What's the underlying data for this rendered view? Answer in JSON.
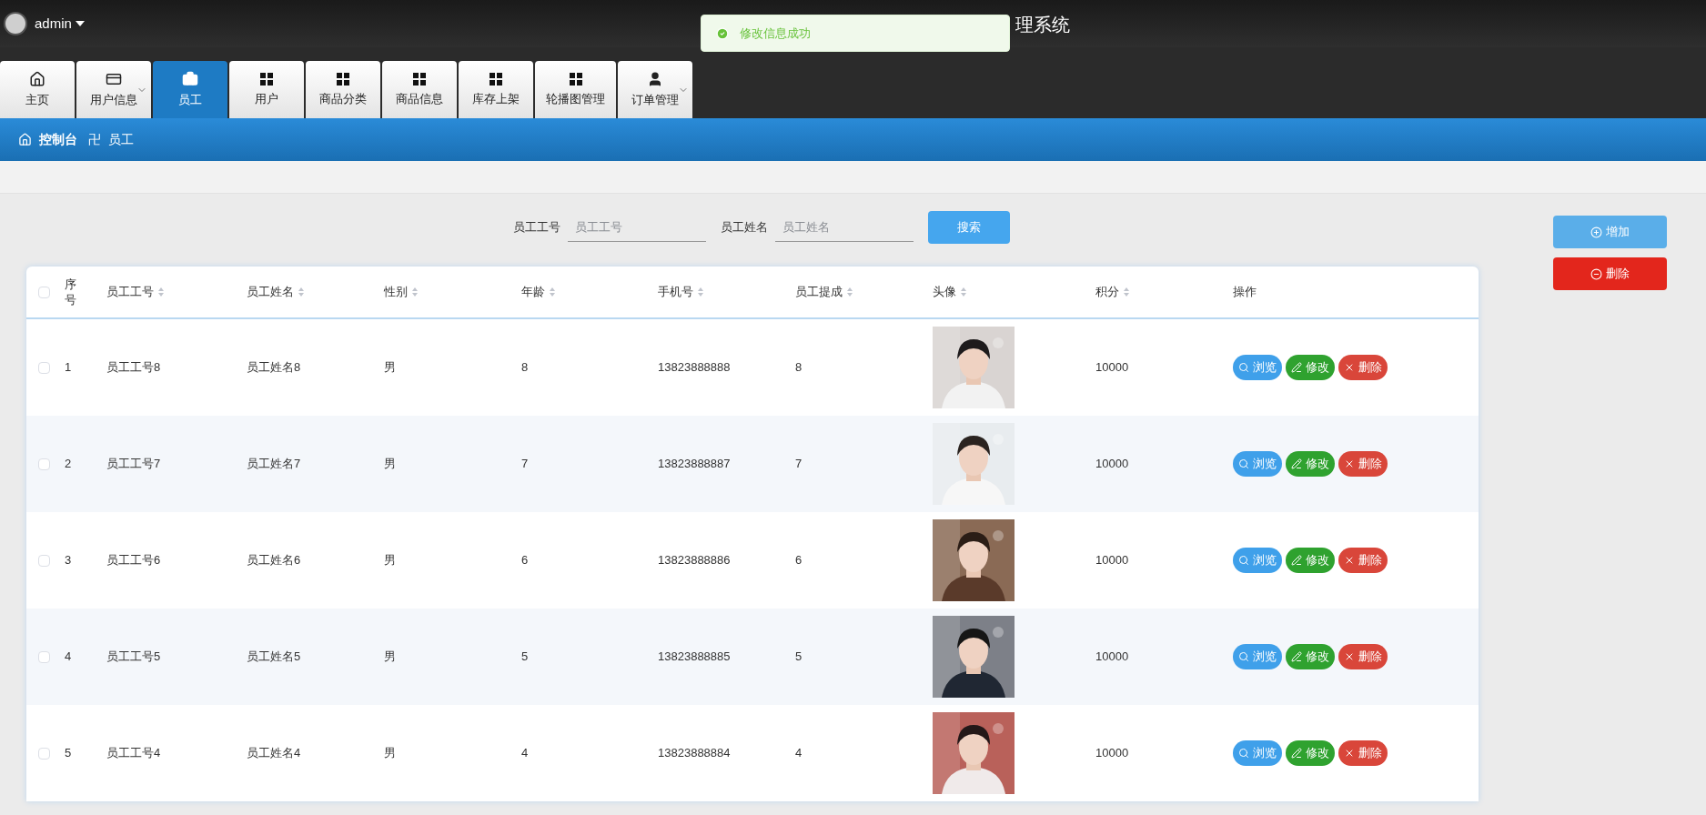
{
  "header": {
    "user": "admin",
    "title": "理系统"
  },
  "toast": {
    "message": "修改信息成功"
  },
  "tabs": [
    {
      "label": "主页",
      "kind": "home",
      "dropdown": false,
      "selected": false
    },
    {
      "label": "用户信息",
      "kind": "card",
      "dropdown": true,
      "selected": false
    },
    {
      "label": "员工",
      "kind": "briefcase",
      "dropdown": false,
      "selected": true
    },
    {
      "label": "用户",
      "kind": "grid",
      "dropdown": false,
      "selected": false
    },
    {
      "label": "商品分类",
      "kind": "grid",
      "dropdown": false,
      "selected": false
    },
    {
      "label": "商品信息",
      "kind": "grid",
      "dropdown": false,
      "selected": false
    },
    {
      "label": "库存上架",
      "kind": "grid",
      "dropdown": false,
      "selected": false
    },
    {
      "label": "轮播图管理",
      "kind": "grid",
      "dropdown": false,
      "selected": false
    },
    {
      "label": "订单管理",
      "kind": "user",
      "dropdown": true,
      "selected": false
    }
  ],
  "breadcrumb": {
    "home": "控制台",
    "separator": "卍",
    "current": "员工"
  },
  "search": {
    "fields": [
      {
        "label": "员工工号",
        "placeholder": "员工工号"
      },
      {
        "label": "员工姓名",
        "placeholder": "员工姓名"
      }
    ],
    "button": "搜索"
  },
  "actions": {
    "add": "增加",
    "delete": "删除"
  },
  "table": {
    "all_checked": false,
    "columns": [
      {
        "label": "序号",
        "sortable": false
      },
      {
        "label": "员工工号",
        "sortable": true
      },
      {
        "label": "员工姓名",
        "sortable": true
      },
      {
        "label": "性别",
        "sortable": true
      },
      {
        "label": "年龄",
        "sortable": true
      },
      {
        "label": "手机号",
        "sortable": true
      },
      {
        "label": "员工提成",
        "sortable": true
      },
      {
        "label": "头像",
        "sortable": true
      },
      {
        "label": "积分",
        "sortable": true
      },
      {
        "label": "操作",
        "sortable": false
      }
    ],
    "rows": [
      {
        "checked": false,
        "cells": [
          "1",
          "员工工号8",
          "员工姓名8",
          "男",
          "8",
          "13823888888",
          "8"
        ],
        "points": "10000",
        "buttons": [
          "浏览",
          "修改",
          "删除"
        ]
      },
      {
        "checked": false,
        "cells": [
          "2",
          "员工工号7",
          "员工姓名7",
          "男",
          "7",
          "13823888887",
          "7"
        ],
        "points": "10000",
        "buttons": [
          "浏览",
          "修改",
          "删除"
        ]
      },
      {
        "checked": false,
        "cells": [
          "3",
          "员工工号6",
          "员工姓名6",
          "男",
          "6",
          "13823888886",
          "6"
        ],
        "points": "10000",
        "buttons": [
          "浏览",
          "修改",
          "删除"
        ]
      },
      {
        "checked": false,
        "cells": [
          "4",
          "员工工号5",
          "员工姓名5",
          "男",
          "5",
          "13823888885",
          "5"
        ],
        "points": "10000",
        "buttons": [
          "浏览",
          "修改",
          "删除"
        ]
      },
      {
        "checked": false,
        "cells": [
          "5",
          "员工工号4",
          "员工姓名4",
          "男",
          "4",
          "13823888884",
          "4"
        ],
        "points": "10000",
        "buttons": [
          "浏览",
          "修改",
          "删除"
        ]
      }
    ]
  }
}
